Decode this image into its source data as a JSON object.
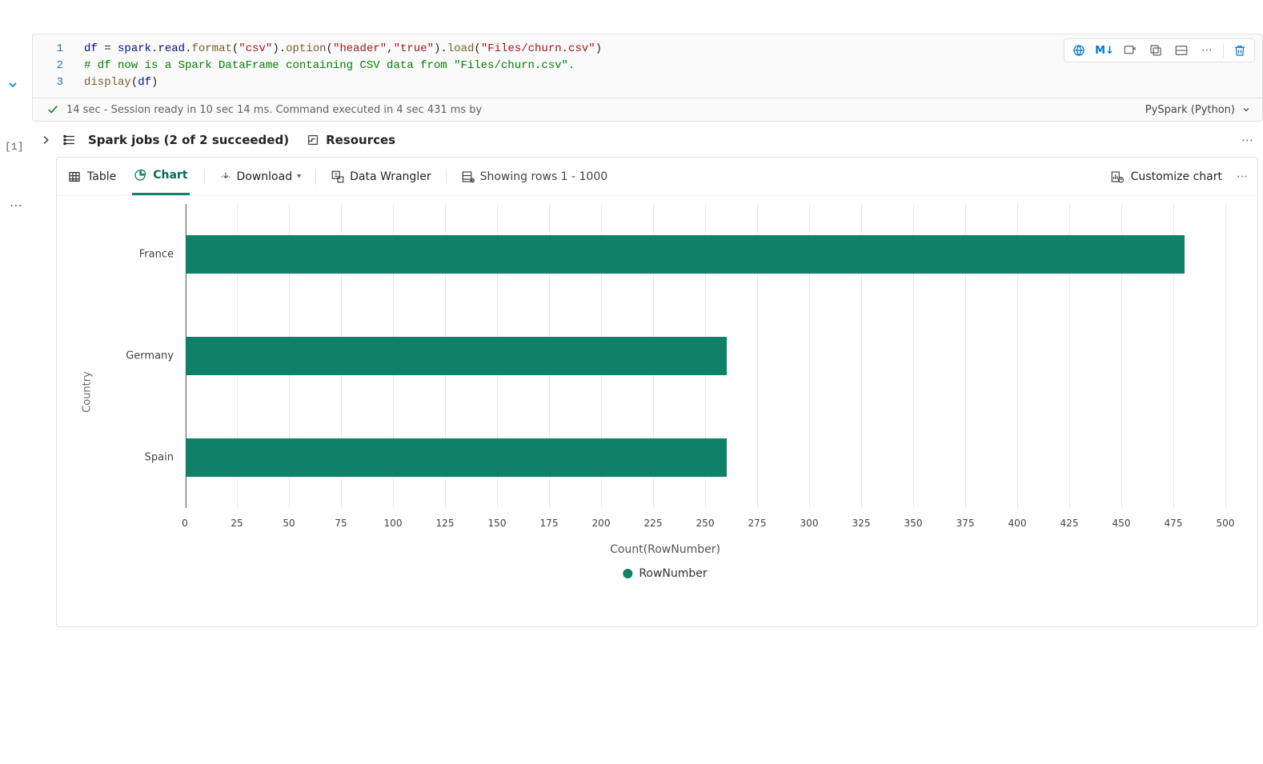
{
  "cell_number_label": "[1]",
  "code": {
    "line_numbers": [
      "1",
      "2",
      "3"
    ],
    "lines": {
      "l1_frag1": "df",
      "l1_frag2": " = ",
      "l1_frag3": "spark",
      "l1_frag4": ".",
      "l1_frag5": "read",
      "l1_frag6": ".",
      "l1_frag7": "format",
      "l1_frag8": "(",
      "l1_str1": "\"csv\"",
      "l1_frag9": ").",
      "l1_frag10": "option",
      "l1_frag11": "(",
      "l1_str2": "\"header\"",
      "l1_comma": ",",
      "l1_str3": "\"true\"",
      "l1_frag12": ").",
      "l1_frag13": "load",
      "l1_frag14": "(",
      "l1_str4": "\"Files/churn.csv\"",
      "l1_frag15": ")",
      "l2_com": "# df now is a Spark DataFrame containing CSV data from \"Files/churn.csv\".",
      "l3_fn": "display",
      "l3_p1": "(",
      "l3_var": "df",
      "l3_p2": ")"
    }
  },
  "toolbar_md_label": "M↓",
  "status": {
    "duration": "14 sec",
    "detail": "Session ready in 10 sec 14 ms. Command executed in 4 sec 431 ms by",
    "kernel": "PySpark (Python)"
  },
  "jobs": {
    "label": "Spark jobs (2 of 2 succeeded)"
  },
  "resources_label": "Resources",
  "output_tabs": {
    "table": "Table",
    "chart": "Chart"
  },
  "download_label": "Download",
  "data_wrangler_label": "Data Wrangler",
  "rows_label": "Showing rows 1 - 1000",
  "customize_label": "Customize chart",
  "chart_data": {
    "type": "bar",
    "orientation": "horizontal",
    "series": [
      {
        "name": "RowNumber",
        "values": [
          480,
          260,
          260
        ]
      }
    ],
    "categories": [
      "France",
      "Germany",
      "Spain"
    ],
    "xlabel": "Count(RowNumber)",
    "ylabel": "Country",
    "xlim": [
      0,
      500
    ],
    "xticks": [
      0,
      25,
      50,
      75,
      100,
      125,
      150,
      175,
      200,
      225,
      250,
      275,
      300,
      325,
      350,
      375,
      400,
      425,
      450,
      475,
      500
    ],
    "legend": [
      "RowNumber"
    ],
    "bar_color": "#0f8169"
  }
}
